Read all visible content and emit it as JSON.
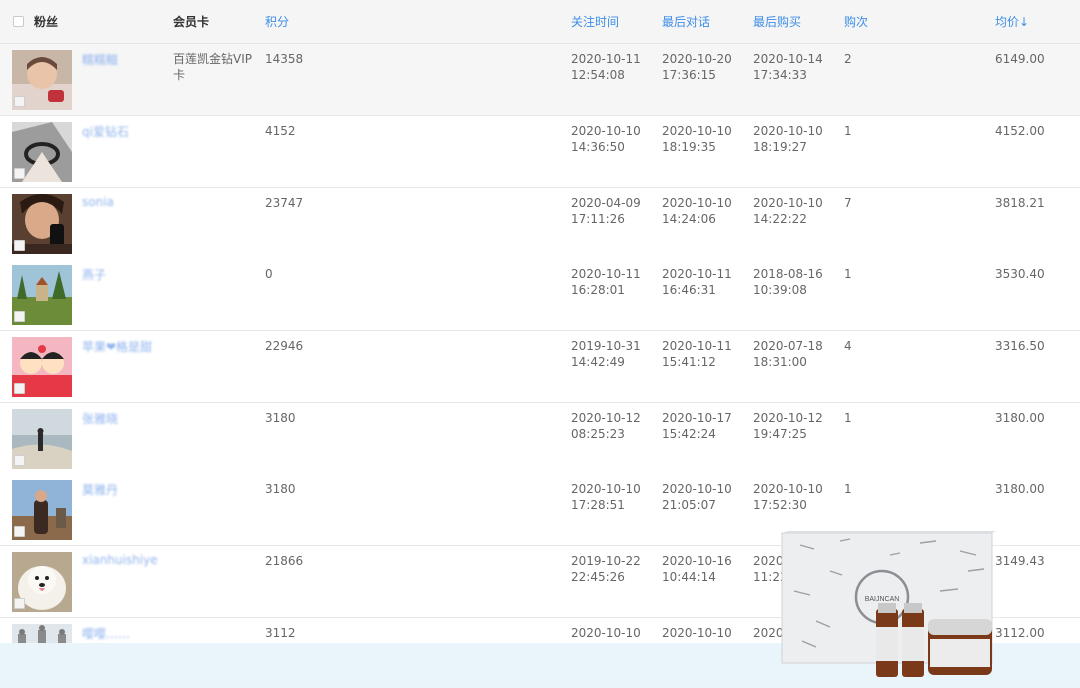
{
  "header": {
    "fans": "粉丝",
    "card": "会员卡",
    "points": "积分",
    "follow_time": "关注时间",
    "last_chat": "最后对话",
    "last_buy": "最后购买",
    "buy_count": "购次",
    "avg_price": "均价↓"
  },
  "rows": [
    {
      "name": "糯糯糍",
      "card": "百莲凯金钻VIP卡",
      "points": "14358",
      "follow": [
        "2020-10-11",
        "12:54:08"
      ],
      "chat": [
        "2020-10-20",
        "17:36:15"
      ],
      "buy": [
        "2020-10-14",
        "17:34:33"
      ],
      "count": "2",
      "avg": "6149.00"
    },
    {
      "name": "qi爱钻石",
      "card": "",
      "points": "4152",
      "follow": [
        "2020-10-10",
        "14:36:50"
      ],
      "chat": [
        "2020-10-10",
        "18:19:35"
      ],
      "buy": [
        "2020-10-10",
        "18:19:27"
      ],
      "count": "1",
      "avg": "4152.00"
    },
    {
      "name": "sonia",
      "card": "",
      "points": "23747",
      "follow": [
        "2020-04-09",
        "17:11:26"
      ],
      "chat": [
        "2020-10-10",
        "14:24:06"
      ],
      "buy": [
        "2020-10-10",
        "14:22:22"
      ],
      "count": "7",
      "avg": "3818.21"
    },
    {
      "name": "燕子",
      "card": "",
      "points": "0",
      "follow": [
        "2020-10-11",
        "16:28:01"
      ],
      "chat": [
        "2020-10-11",
        "16:46:31"
      ],
      "buy": [
        "2018-08-16",
        "10:39:08"
      ],
      "count": "1",
      "avg": "3530.40"
    },
    {
      "name": "苹果❤格是甜",
      "card": "",
      "points": "22946",
      "follow": [
        "2019-10-31",
        "14:42:49"
      ],
      "chat": [
        "2020-10-11",
        "15:41:12"
      ],
      "buy": [
        "2020-07-18",
        "18:31:00"
      ],
      "count": "4",
      "avg": "3316.50"
    },
    {
      "name": "张雅晓",
      "card": "",
      "points": "3180",
      "follow": [
        "2020-10-12",
        "08:25:23"
      ],
      "chat": [
        "2020-10-17",
        "15:42:24"
      ],
      "buy": [
        "2020-10-12",
        "19:47:25"
      ],
      "count": "1",
      "avg": "3180.00"
    },
    {
      "name": "莫雅丹",
      "card": "",
      "points": "3180",
      "follow": [
        "2020-10-10",
        "17:28:51"
      ],
      "chat": [
        "2020-10-10",
        "21:05:07"
      ],
      "buy": [
        "2020-10-10",
        "17:52:30"
      ],
      "count": "1",
      "avg": "3180.00"
    },
    {
      "name": "xianhuishiye",
      "card": "",
      "points": "21866",
      "follow": [
        "2019-10-22",
        "22:45:26"
      ],
      "chat": [
        "2020-10-16",
        "10:44:14"
      ],
      "buy": [
        "2020-",
        "11:22"
      ],
      "count": "",
      "avg": "3149.43"
    },
    {
      "name": "嘤嘤……",
      "card": "",
      "points": "3112",
      "follow": [
        "2020-10-10",
        ""
      ],
      "chat": [
        "2020-10-10",
        ""
      ],
      "buy": [
        "2020-",
        ""
      ],
      "count": "",
      "avg": "3112.00"
    }
  ],
  "product_overlay": {
    "brand": "BAIJNCAN",
    "icon": "product-box-image"
  },
  "colors": {
    "link": "#3d8ee6",
    "name_link": "#8fb3ee",
    "header_bg": "#f5f5f5",
    "highlight_row": "#f6f6f6",
    "bottom_bar": "#e9f5fb"
  }
}
